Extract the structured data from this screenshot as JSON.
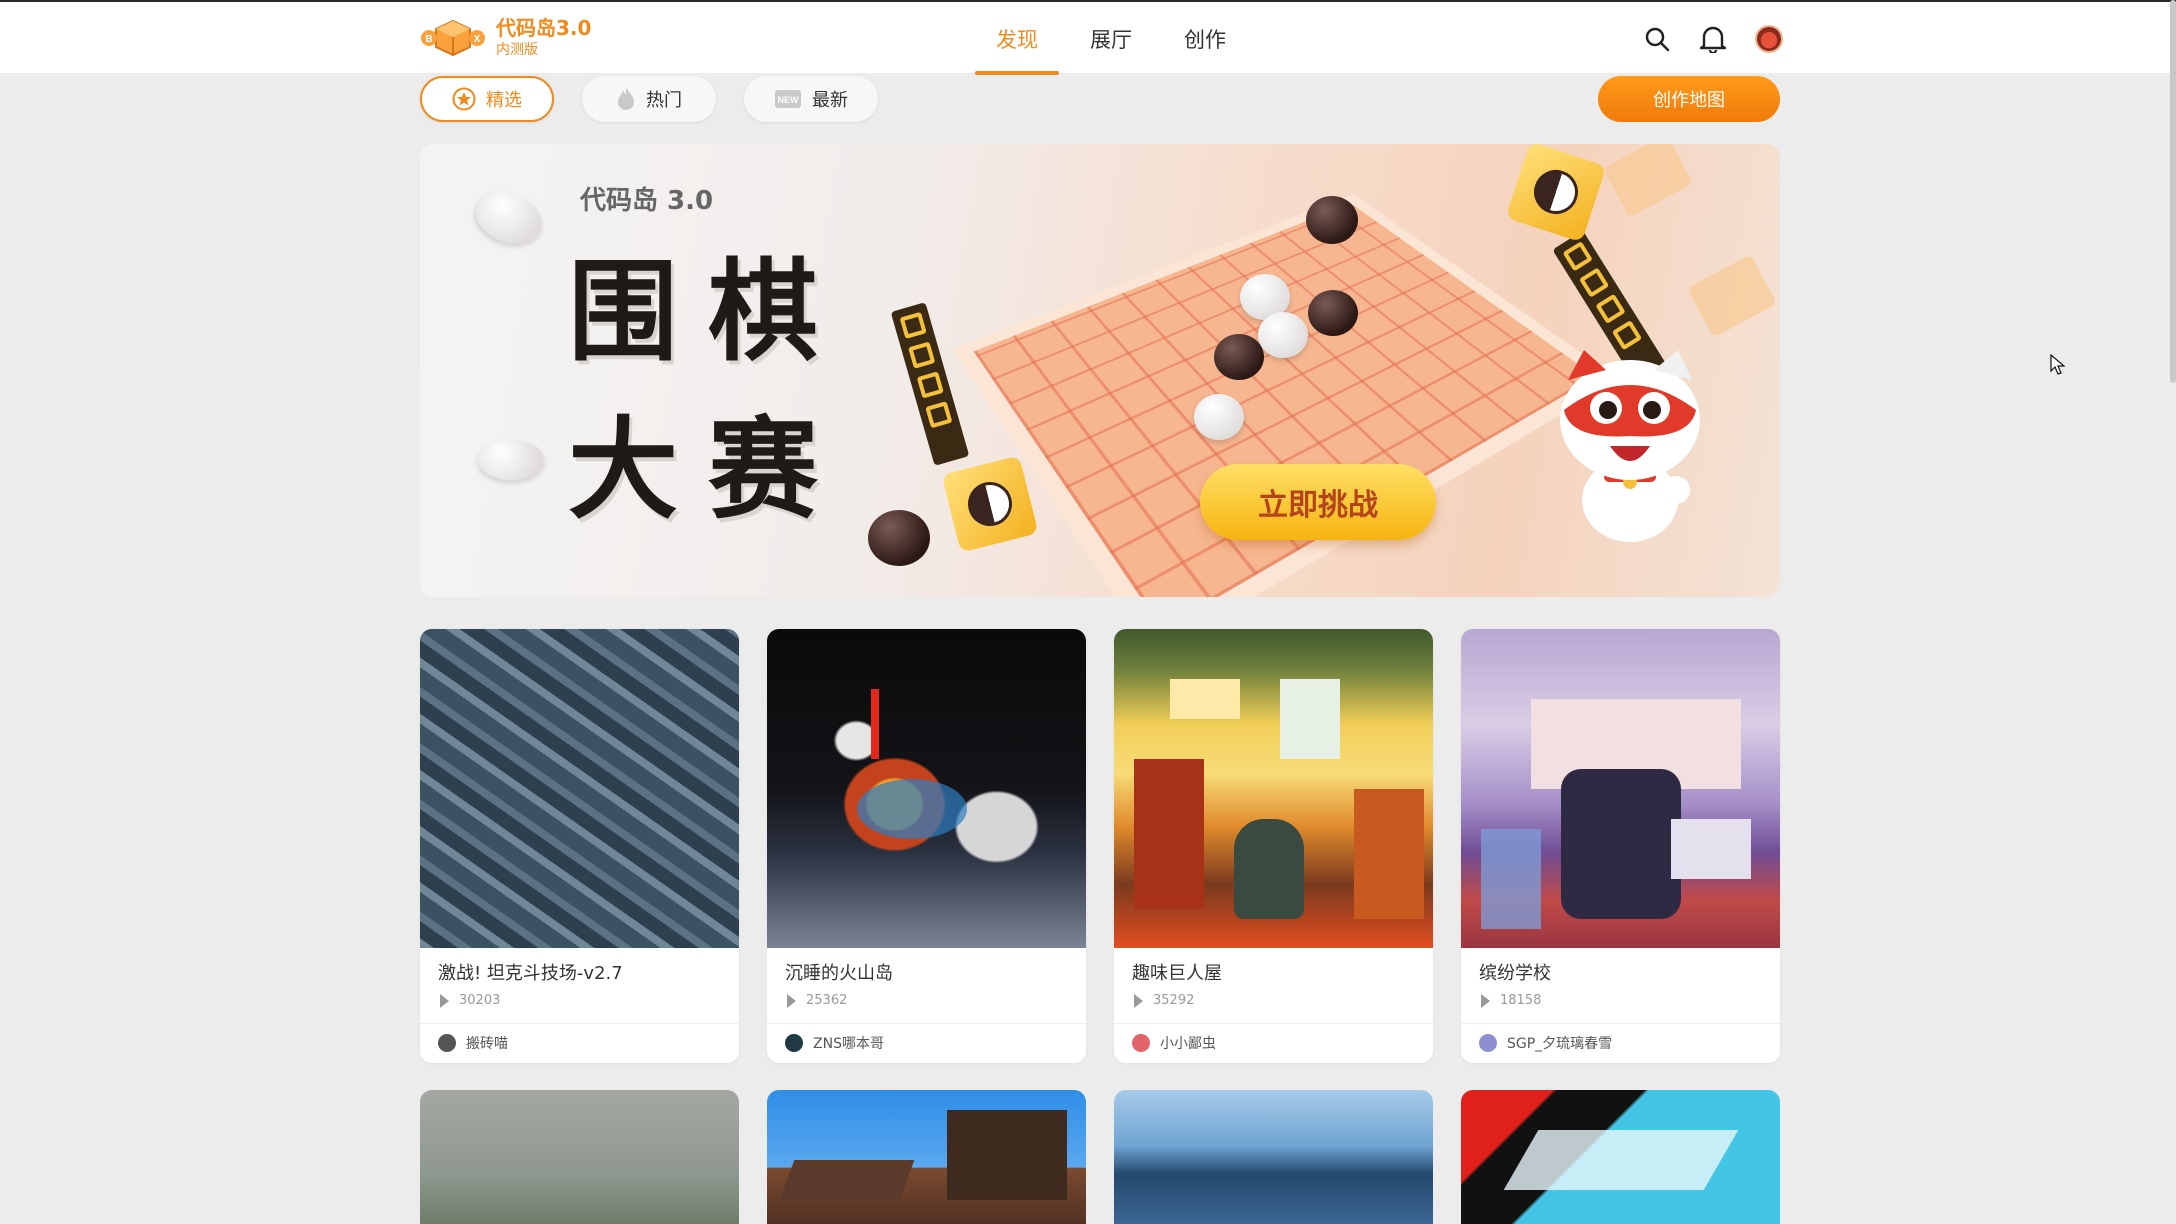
{
  "app": {
    "logo_title": "代码岛3.0",
    "logo_sub": "内测版",
    "accent_color": "#f08a1c"
  },
  "nav": {
    "items": [
      {
        "label": "发现",
        "active": true
      },
      {
        "label": "展厅",
        "active": false
      },
      {
        "label": "创作",
        "active": false
      }
    ]
  },
  "top_icons": [
    "search-icon",
    "bell-icon",
    "user-avatar"
  ],
  "filters": {
    "items": [
      {
        "label": "精选",
        "icon": "star-icon",
        "active": true
      },
      {
        "label": "热门",
        "icon": "flame-icon",
        "active": false
      },
      {
        "label": "最新",
        "icon": "new-badge-icon",
        "active": false
      }
    ],
    "create_map_label": "创作地图"
  },
  "banner": {
    "title": "代码岛 3.0",
    "headline_1": "围棋",
    "headline_2": "大赛",
    "cta": "立即挑战"
  },
  "cards": [
    {
      "title": "激战! 坦克斗技场-v2.7",
      "plays": "30203",
      "author": "搬砖喵"
    },
    {
      "title": "沉睡的火山岛",
      "plays": "25362",
      "author": "ZNS哪本哥"
    },
    {
      "title": "趣味巨人屋",
      "plays": "35292",
      "author": "小小鄙虫"
    },
    {
      "title": "缤纷学校",
      "plays": "18158",
      "author": "SGP_夕琉璃春雪"
    }
  ]
}
